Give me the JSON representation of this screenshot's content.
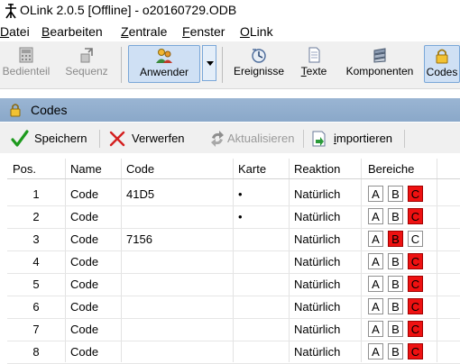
{
  "window": {
    "title": "OLink 2.0.5 [Offline] - o20160729.ODB"
  },
  "menu": [
    {
      "label": "Datei",
      "key": "D",
      "rest": "atei"
    },
    {
      "label": "Bearbeiten",
      "key": "B",
      "rest": "earbeiten"
    },
    {
      "label": "Zentrale",
      "key": "Z",
      "rest": "entrale"
    },
    {
      "label": "Fenster",
      "key": "F",
      "rest": "enster"
    },
    {
      "label": "OLink",
      "key": "O",
      "rest": "Link"
    }
  ],
  "toolbar": {
    "bedienteil": "Bedienteil",
    "sequenz": "Sequenz",
    "anwender": "Anwender",
    "ereignisse": "Ereignisse",
    "texte_key": "T",
    "texte_rest": "exte",
    "komponenten": "Komponenten",
    "codes": "Codes"
  },
  "panel": {
    "title": "Codes"
  },
  "subtoolbar": {
    "speichern": "Speichern",
    "verwerfen": "Verwerfen",
    "aktualisieren": "Aktualisieren",
    "importieren_key": "i",
    "importieren_rest": "mportieren"
  },
  "table": {
    "columns": [
      "Pos.",
      "Name",
      "Code",
      "Karte",
      "Reaktion",
      "Bereiche"
    ],
    "rows": [
      {
        "pos": "1",
        "name": "Code",
        "code": "41D5",
        "karte": "•",
        "reaktion": "Natürlich",
        "bereiche": {
          "A": false,
          "B": false,
          "C": true
        }
      },
      {
        "pos": "2",
        "name": "Code",
        "code": "",
        "karte": "•",
        "reaktion": "Natürlich",
        "bereiche": {
          "A": false,
          "B": false,
          "C": true
        }
      },
      {
        "pos": "3",
        "name": "Code",
        "code": "7156",
        "karte": "",
        "reaktion": "Natürlich",
        "bereiche": {
          "A": false,
          "B": true,
          "C": false
        }
      },
      {
        "pos": "4",
        "name": "Code",
        "code": "",
        "karte": "",
        "reaktion": "Natürlich",
        "bereiche": {
          "A": false,
          "B": false,
          "C": true
        }
      },
      {
        "pos": "5",
        "name": "Code",
        "code": "",
        "karte": "",
        "reaktion": "Natürlich",
        "bereiche": {
          "A": false,
          "B": false,
          "C": true
        }
      },
      {
        "pos": "6",
        "name": "Code",
        "code": "",
        "karte": "",
        "reaktion": "Natürlich",
        "bereiche": {
          "A": false,
          "B": false,
          "C": true
        }
      },
      {
        "pos": "7",
        "name": "Code",
        "code": "",
        "karte": "",
        "reaktion": "Natürlich",
        "bereiche": {
          "A": false,
          "B": false,
          "C": true
        }
      },
      {
        "pos": "8",
        "name": "Code",
        "code": "",
        "karte": "",
        "reaktion": "Natürlich",
        "bereiche": {
          "A": false,
          "B": false,
          "C": true
        }
      }
    ],
    "area_labels": [
      "A",
      "B",
      "C"
    ]
  },
  "colors": {
    "area_active": "#ee1111",
    "panel_header": "#9ab5d3",
    "accept": "#1e9a1e",
    "reject": "#d42020"
  }
}
